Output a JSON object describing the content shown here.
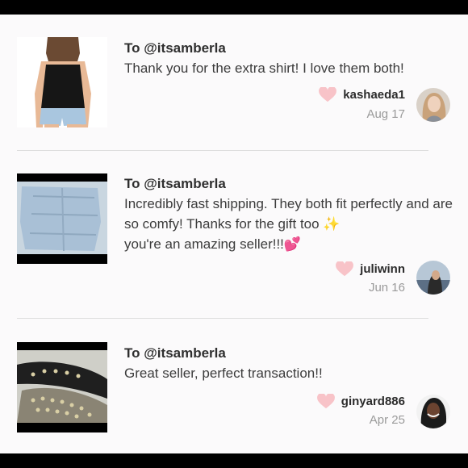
{
  "reviews": [
    {
      "to": "To @itsamberla",
      "message": "Thank you for the extra shirt! I love them both!",
      "username": "kashaeda1",
      "date": "Aug 17"
    },
    {
      "to": "To @itsamberla",
      "message": "Incredibly fast shipping. They both fit perfectly and are so comfy! Thanks for the gift too ",
      "message_tail": "you're an amazing seller!!!",
      "emoji_sparkle": "✨",
      "emoji_hearts": "💕",
      "username": "juliwinn",
      "date": "Jun 16"
    },
    {
      "to": "To @itsamberla",
      "message": "Great seller, perfect transaction!!",
      "username": "ginyard886",
      "date": "Apr 25"
    }
  ],
  "colors": {
    "heart": "#f8c3c8",
    "letterbox": "#000000",
    "background": "#fbfafb",
    "divider": "#dedede"
  },
  "icons": [
    "heart-icon",
    "avatar"
  ]
}
